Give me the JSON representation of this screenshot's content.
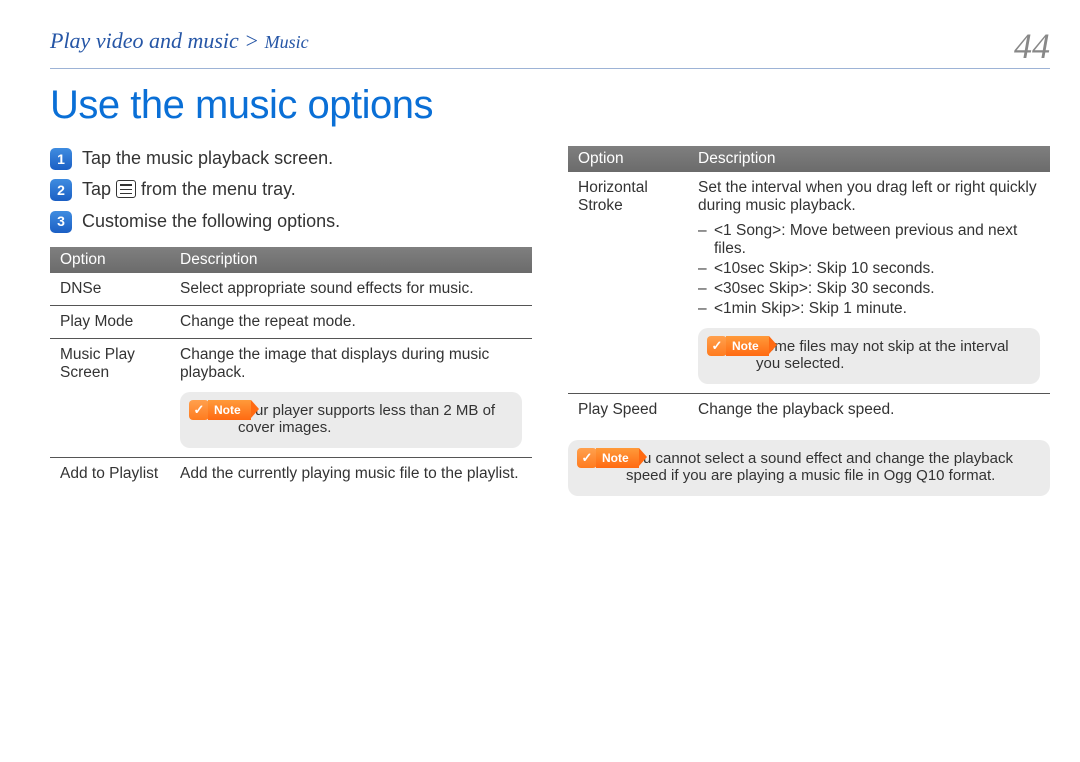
{
  "header": {
    "breadcrumb_main": "Play video and music >",
    "breadcrumb_sub": "Music",
    "page_number": "44"
  },
  "title": "Use the music options",
  "steps": [
    {
      "num": "1",
      "text": "Tap the music playback screen."
    },
    {
      "num": "2",
      "prefix": "Tap ",
      "suffix": " from the menu tray."
    },
    {
      "num": "3",
      "text": "Customise the following options."
    }
  ],
  "table_headers": {
    "option": "Option",
    "description": "Description"
  },
  "table_left": {
    "dnse": {
      "name": "DNSe",
      "desc": "Select appropriate sound effects for music."
    },
    "play_mode": {
      "name": "Play Mode",
      "desc": "Change the repeat mode."
    },
    "music_play_screen": {
      "name": "Music Play Screen",
      "desc": "Change the image that displays during music playback.",
      "note": "Your player supports less than 2 MB of cover images."
    },
    "add_to_playlist": {
      "name": "Add to Playlist",
      "desc": "Add the currently playing music file to the playlist."
    }
  },
  "table_right": {
    "horizontal_stroke": {
      "name": "Horizontal Stroke",
      "desc": "Set the interval when you drag left or right quickly during music playback.",
      "items": [
        "<1 Song>: Move between previous and next files.",
        "<10sec Skip>: Skip 10 seconds.",
        "<30sec Skip>: Skip 30 seconds.",
        "<1min Skip>: Skip 1 minute."
      ],
      "note": "Some files may not skip at the interval you selected."
    },
    "play_speed": {
      "name": "Play Speed",
      "desc": "Change the playback speed."
    }
  },
  "final_note": "You cannot select a sound effect and change the playback speed if you are playing a music file in Ogg Q10 format.",
  "labels": {
    "note": "Note"
  }
}
